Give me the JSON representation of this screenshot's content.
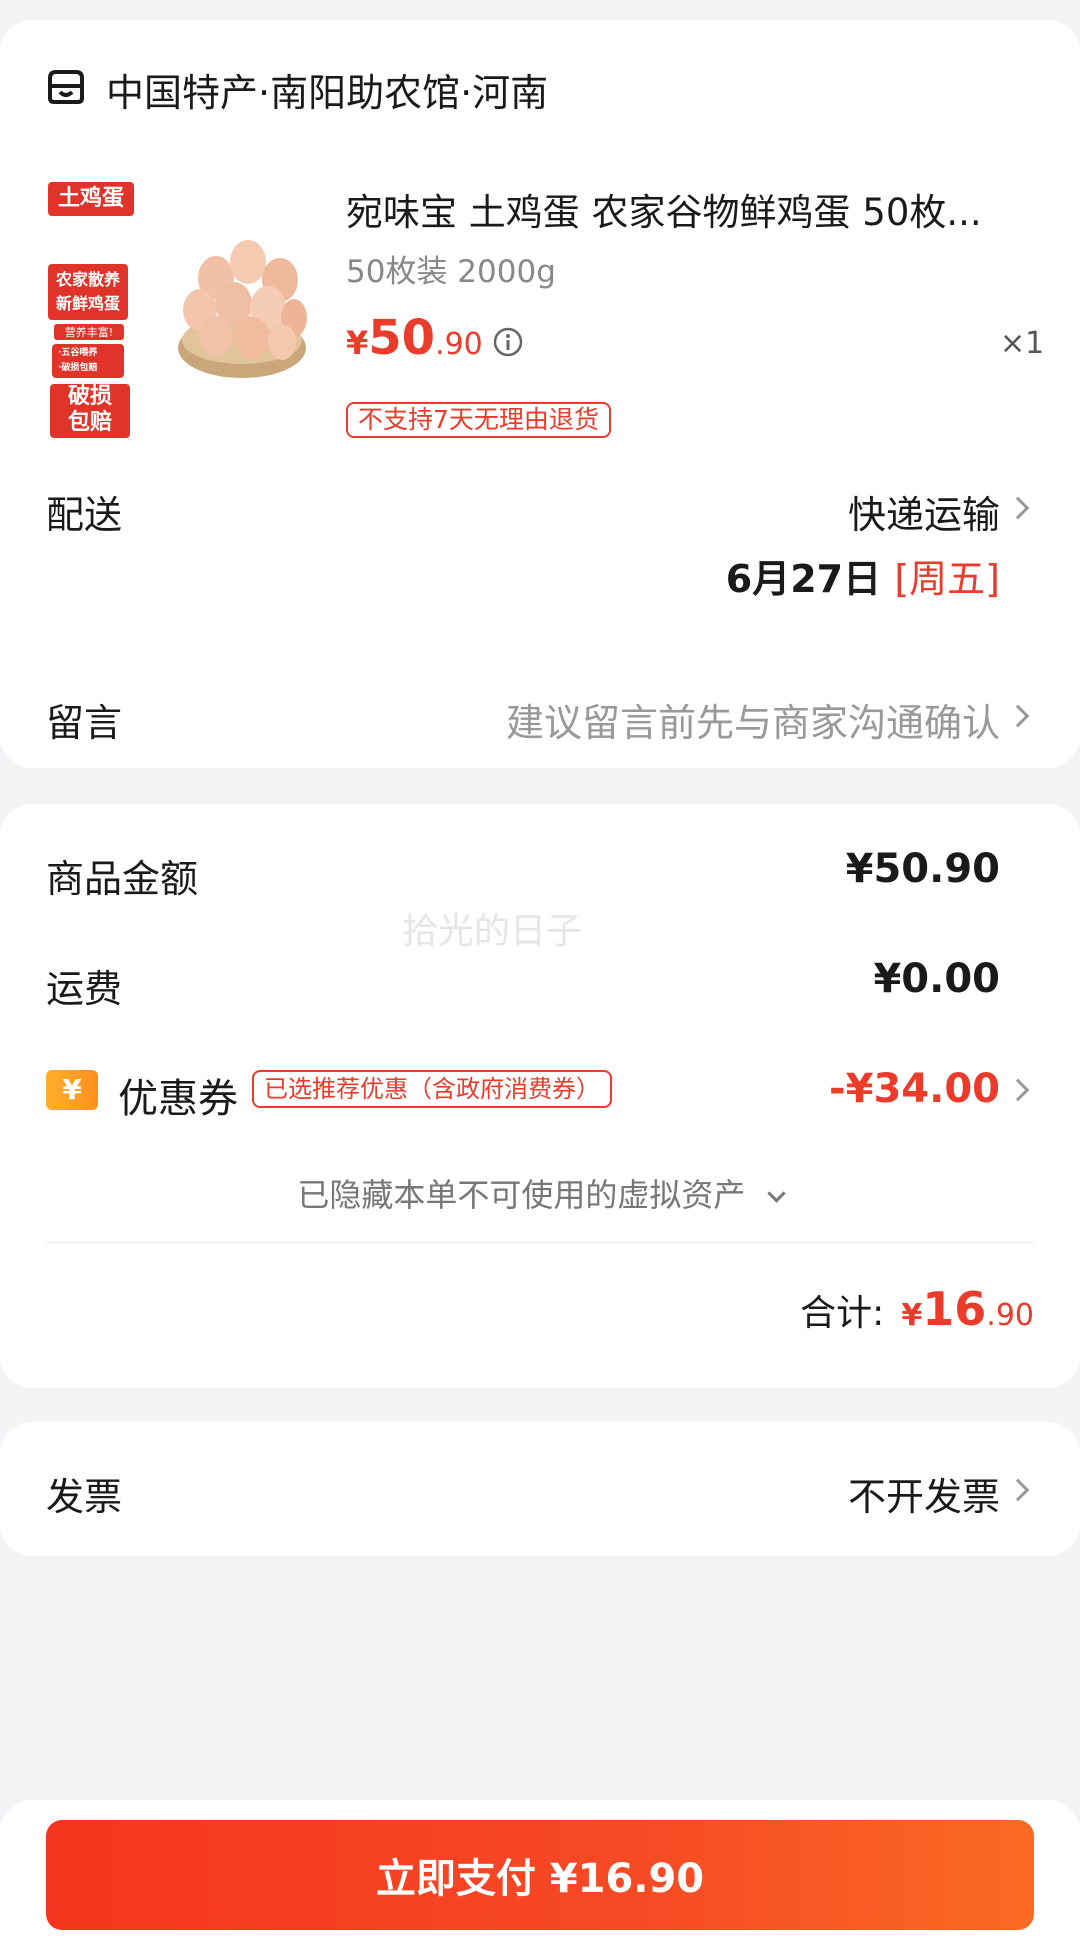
{
  "store": {
    "icon": "store-icon",
    "name": "中国特产·南阳助农馆·河南"
  },
  "product": {
    "image_tag_top": "土鸡蛋",
    "image_tag_mid_1": "农家散养",
    "image_tag_mid_2": "新鲜鸡蛋",
    "image_tag_small": "营养丰富!",
    "image_bullet_1": "·五谷喂养",
    "image_bullet_2": "·破损包赔",
    "image_tag_bottom_1": "破损",
    "image_tag_bottom_2": "包赔",
    "title": "宛味宝 土鸡蛋 农家谷物鲜鸡蛋 50枚...",
    "spec": "50枚装 2000g",
    "price_symbol": "¥",
    "price_int": "50",
    "price_dec": ".90",
    "quantity": "×1",
    "return_tag": "不支持7天无理由退货"
  },
  "delivery": {
    "label": "配送",
    "method": "快递运输",
    "date": "6月27日",
    "weekday": "[周五]"
  },
  "message": {
    "label": "留言",
    "placeholder": "建议留言前先与商家沟通确认"
  },
  "summary": {
    "goods_label": "商品金额",
    "goods_value": "¥50.90",
    "shipping_label": "运费",
    "shipping_value": "¥0.00",
    "coupon_icon": "¥",
    "coupon_label": "优惠券",
    "coupon_tag": "已选推荐优惠（含政府消费券）",
    "coupon_value": "-¥34.00",
    "hidden_assets": "已隐藏本单不可使用的虚拟资产",
    "total_label": "合计:",
    "total_symbol": "¥",
    "total_int": "16",
    "total_dec": ".90",
    "watermark": "拾光的日子"
  },
  "invoice": {
    "label": "发票",
    "value": "不开发票"
  },
  "pay": {
    "label": "立即支付 ¥16.90"
  },
  "colors": {
    "accent": "#ea3b2b",
    "background": "#f4f4f6"
  }
}
